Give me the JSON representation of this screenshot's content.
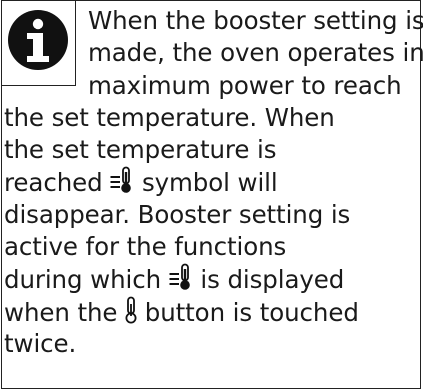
{
  "note": {
    "icon": "info-icon",
    "lines": {
      "l1": "When the booster setting is",
      "l2": "made, the oven operates in",
      "l3": "maximum power to reach",
      "l4": "the set temperature. When",
      "l5": "the set temperature is",
      "l6a": "reached",
      "l6b": "symbol will",
      "l7": "disappear. Booster setting is",
      "l8": "active for the functions",
      "l9a": "during which",
      "l9b": "is displayed",
      "l10a": "when the",
      "l10b": "button is touched",
      "l11": "twice."
    },
    "symbols": {
      "booster": "booster-thermometer-icon",
      "thermometer": "thermometer-icon"
    }
  }
}
